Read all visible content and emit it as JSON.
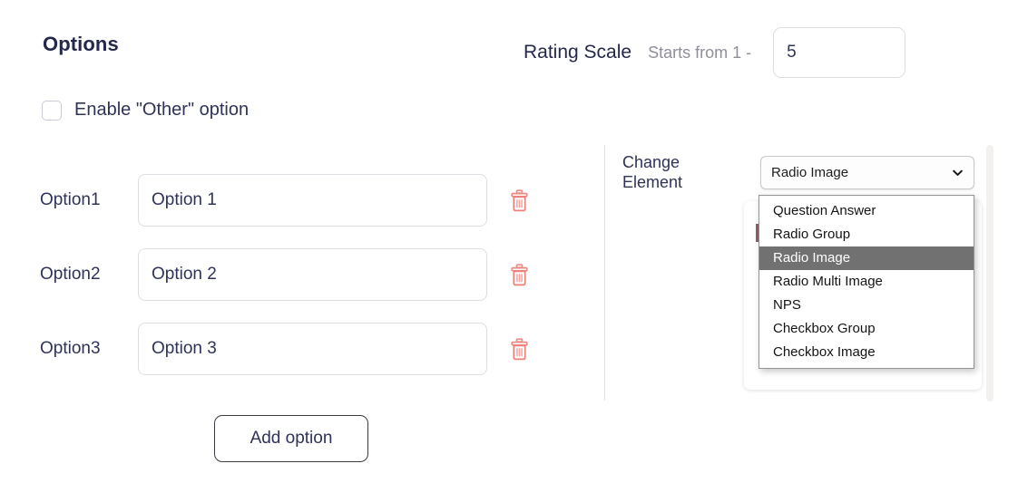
{
  "options_panel": {
    "heading": "Options",
    "enable_other": {
      "label": "Enable \"Other\" option",
      "checked": false
    },
    "rows": [
      {
        "label": "Option1",
        "value": "Option 1",
        "delete_icon": "trash-icon"
      },
      {
        "label": "Option2",
        "value": "Option 2",
        "delete_icon": "trash-icon"
      },
      {
        "label": "Option3",
        "value": "Option 3",
        "delete_icon": "trash-icon"
      }
    ],
    "add_option_label": "Add option"
  },
  "rating_scale": {
    "label": "Rating Scale",
    "hint": "Starts from 1 -",
    "value": "5",
    "placeholder": ""
  },
  "change_element": {
    "label": "Change\nElement",
    "label_line1": "Change",
    "label_line2": "Element",
    "selected": "Radio Image",
    "chevron_icon": "chevron-down-icon",
    "expanded": true,
    "options": [
      "Question Answer",
      "Radio Group",
      "Radio Image",
      "Radio Multi Image",
      "NPS",
      "Checkbox Group",
      "Checkbox Image"
    ]
  },
  "colors": {
    "text_primary": "#2f3358",
    "heading": "#24284a",
    "muted": "#8f8f9c",
    "delete_icon": "#f0847e",
    "dropdown_highlight": "#717171",
    "border": "#dcdee3",
    "button_border": "#3b3b44"
  }
}
